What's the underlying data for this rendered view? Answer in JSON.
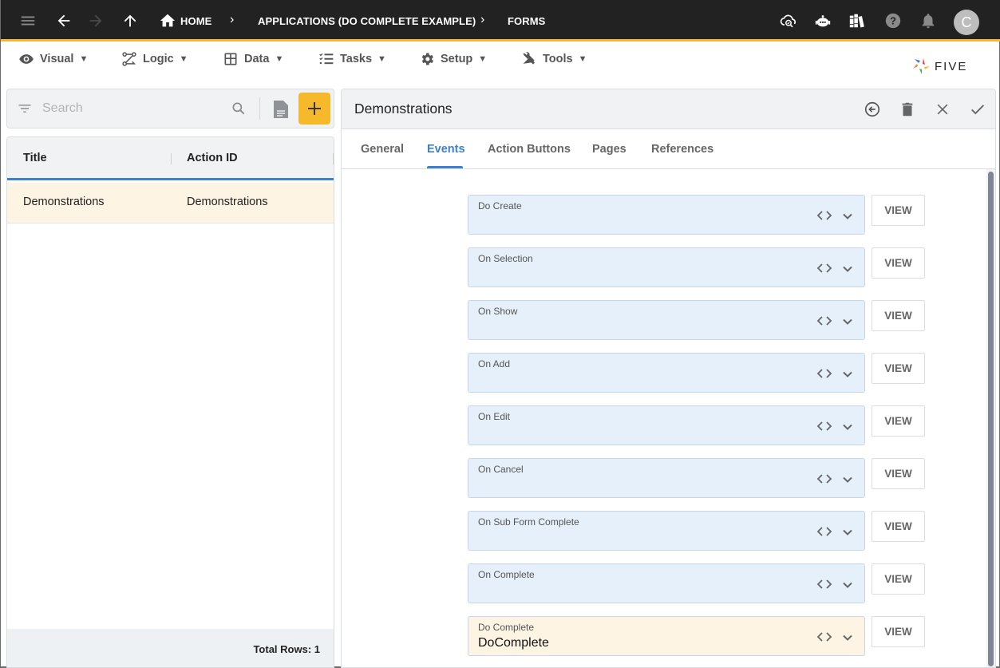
{
  "topbar": {
    "breadcrumbs": [
      "HOME",
      "APPLICATIONS (DO COMPLETE EXAMPLE)",
      "FORMS"
    ],
    "avatar_initial": "C",
    "accent_color": "#f6b92c",
    "icons": [
      "menu-icon",
      "back-arrow-icon",
      "forward-arrow-icon",
      "up-arrow-icon",
      "home-icon",
      "cloud-search-icon",
      "chatbot-icon",
      "library-books-icon",
      "help-icon",
      "notifications-bell-icon"
    ]
  },
  "menubar": {
    "items": [
      {
        "label": "Visual",
        "icon": "eye-icon"
      },
      {
        "label": "Logic",
        "icon": "flow-icon"
      },
      {
        "label": "Data",
        "icon": "table-grid-icon"
      },
      {
        "label": "Tasks",
        "icon": "checklist-icon"
      },
      {
        "label": "Setup",
        "icon": "gear-icon"
      },
      {
        "label": "Tools",
        "icon": "tools-icon"
      }
    ],
    "caret": "▼",
    "logo_text": "FIVE"
  },
  "search": {
    "placeholder": "Search",
    "value": ""
  },
  "list": {
    "columns": [
      "Title",
      "Action ID"
    ],
    "rows": [
      {
        "title": "Demonstrations",
        "action_id": "Demonstrations"
      }
    ],
    "footer": "Total Rows: 1"
  },
  "form": {
    "title": "Demonstrations",
    "tabs": [
      "General",
      "Events",
      "Action Buttons",
      "Pages",
      "References"
    ],
    "active_tab": "Events",
    "view_label": "VIEW",
    "events": [
      {
        "label": "Do Create",
        "value": ""
      },
      {
        "label": "On Selection",
        "value": ""
      },
      {
        "label": "On Show",
        "value": ""
      },
      {
        "label": "On Add",
        "value": ""
      },
      {
        "label": "On Edit",
        "value": ""
      },
      {
        "label": "On Cancel",
        "value": ""
      },
      {
        "label": "On Sub Form Complete",
        "value": ""
      },
      {
        "label": "On Complete",
        "value": ""
      },
      {
        "label": "Do Complete",
        "value": "DoComplete"
      }
    ]
  }
}
